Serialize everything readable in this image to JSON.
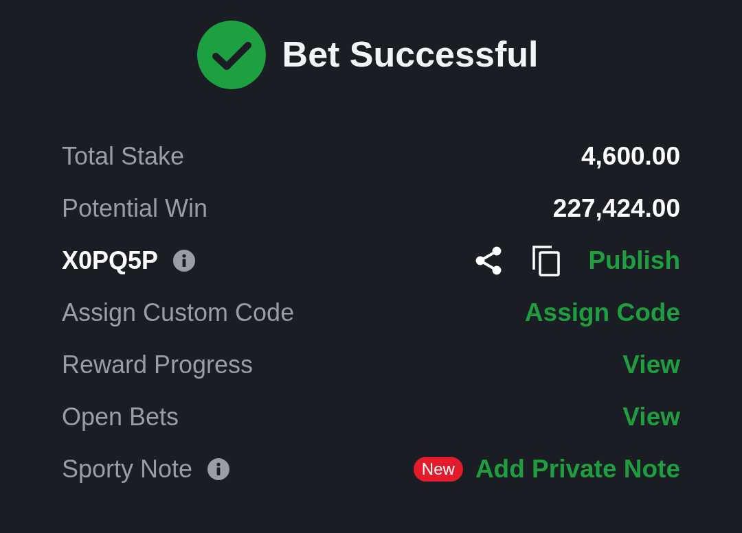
{
  "header": {
    "title": "Bet Successful"
  },
  "rows": [
    {
      "kind": "value",
      "label": "Total Stake",
      "value": "4,600.00"
    },
    {
      "kind": "value",
      "label": "Potential Win",
      "value": "227,424.00"
    },
    {
      "kind": "code",
      "label": "X0PQ5P",
      "info": true,
      "action": "Publish"
    },
    {
      "kind": "action",
      "label": "Assign Custom Code",
      "action": "Assign Code"
    },
    {
      "kind": "action",
      "label": "Reward Progress",
      "action": "View"
    },
    {
      "kind": "action",
      "label": "Open Bets",
      "action": "View"
    },
    {
      "kind": "action",
      "label": "Sporty Note",
      "info": true,
      "badge": "New",
      "action": "Add Private Note"
    }
  ]
}
